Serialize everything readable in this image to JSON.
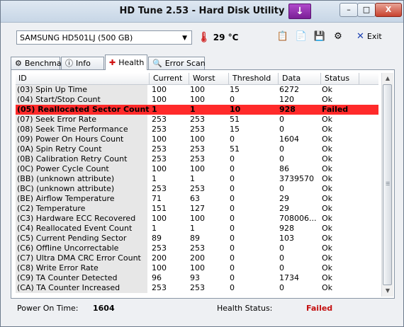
{
  "window": {
    "title": "HD Tune 2.53 - Hard Disk Utility",
    "min": "–",
    "max": "□",
    "close": "X"
  },
  "toolbar": {
    "drive": "SAMSUNG HD501LJ (500 GB)",
    "temperature": "29 °C",
    "exit_label": "Exit"
  },
  "tabs": [
    {
      "label": "Benchmark",
      "icon": "benchmark-icon"
    },
    {
      "label": "Info",
      "icon": "info-icon"
    },
    {
      "label": "Health",
      "icon": "health-icon"
    },
    {
      "label": "Error Scan",
      "icon": "error-scan-icon"
    }
  ],
  "health": {
    "columns": [
      "ID",
      "Current",
      "Worst",
      "Threshold",
      "Data",
      "Status"
    ],
    "rows": [
      [
        "(03) Spin Up Time",
        "100",
        "100",
        "15",
        "6272",
        "Ok"
      ],
      [
        "(04) Start/Stop Count",
        "100",
        "100",
        "0",
        "120",
        "Ok"
      ],
      [
        "(05) Reallocated Sector Count",
        "1",
        "1",
        "10",
        "928",
        "Failed"
      ],
      [
        "(07) Seek Error Rate",
        "253",
        "253",
        "51",
        "0",
        "Ok"
      ],
      [
        "(08) Seek Time Performance",
        "253",
        "253",
        "15",
        "0",
        "Ok"
      ],
      [
        "(09) Power On Hours Count",
        "100",
        "100",
        "0",
        "1604",
        "Ok"
      ],
      [
        "(0A) Spin Retry Count",
        "253",
        "253",
        "51",
        "0",
        "Ok"
      ],
      [
        "(0B) Calibration Retry Count",
        "253",
        "253",
        "0",
        "0",
        "Ok"
      ],
      [
        "(0C) Power Cycle Count",
        "100",
        "100",
        "0",
        "86",
        "Ok"
      ],
      [
        "(BB) (unknown attribute)",
        "1",
        "1",
        "0",
        "3739570",
        "Ok"
      ],
      [
        "(BC) (unknown attribute)",
        "253",
        "253",
        "0",
        "0",
        "Ok"
      ],
      [
        "(BE) Airflow Temperature",
        "71",
        "63",
        "0",
        "29",
        "Ok"
      ],
      [
        "(C2) Temperature",
        "151",
        "127",
        "0",
        "29",
        "Ok"
      ],
      [
        "(C3) Hardware ECC Recovered",
        "100",
        "100",
        "0",
        "708006...",
        "Ok"
      ],
      [
        "(C4) Reallocated Event Count",
        "1",
        "1",
        "0",
        "928",
        "Ok"
      ],
      [
        "(C5) Current Pending Sector",
        "89",
        "89",
        "0",
        "103",
        "Ok"
      ],
      [
        "(C6) Offline Uncorrectable",
        "253",
        "253",
        "0",
        "0",
        "Ok"
      ],
      [
        "(C7) Ultra DMA CRC Error Count",
        "200",
        "200",
        "0",
        "0",
        "Ok"
      ],
      [
        "(C8) Write Error Rate",
        "100",
        "100",
        "0",
        "0",
        "Ok"
      ],
      [
        "(C9) TA Counter Detected",
        "96",
        "93",
        "0",
        "1734",
        "Ok"
      ],
      [
        "(CA) TA Counter Increased",
        "253",
        "253",
        "0",
        "0",
        "Ok"
      ]
    ]
  },
  "footer": {
    "power_on_label": "Power On Time:",
    "power_on_value": "1604",
    "health_label": "Health Status:",
    "health_value": "Failed"
  },
  "colors": {
    "failed_row": "#ff2a2a",
    "failed_text": "#c41010"
  }
}
